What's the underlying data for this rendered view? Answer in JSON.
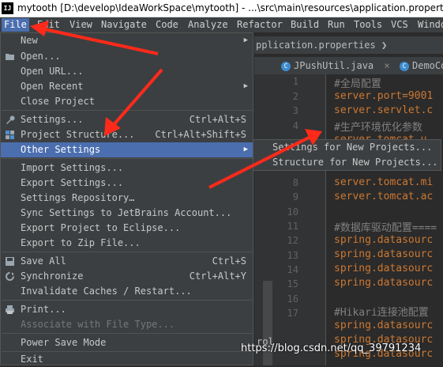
{
  "window": {
    "app_icon_text": "IJ",
    "title": "mytooth [D:\\develop\\IdeaWorkSpace\\mytooth] - ...\\src\\main\\resources\\application.propertie"
  },
  "menubar": {
    "items": [
      "File",
      "Edit",
      "View",
      "Navigate",
      "Code",
      "Analyze",
      "Refactor",
      "Build",
      "Run",
      "Tools",
      "VCS",
      "Windo"
    ]
  },
  "editor": {
    "breadcrumb": "pplication.properties",
    "tabs": [
      {
        "label": "JPushUtil.java",
        "close": "×"
      },
      {
        "label": "DemoCo"
      }
    ],
    "line_numbers": [
      "1",
      "2",
      "3",
      "4",
      "8",
      "9",
      "10",
      "11",
      "12",
      "13",
      "14",
      "15",
      "16",
      "17"
    ],
    "lines": [
      {
        "text": "#全局配置",
        "kind": "comment"
      },
      {
        "text": "server.port=9001",
        "kind": "key"
      },
      {
        "text": "server.servlet.c",
        "kind": "key"
      },
      {
        "text": "#生产环境优化参数",
        "kind": "comment"
      },
      {
        "text": "server.tomcat.u",
        "kind": "key"
      },
      {
        "text": "server.tomcat.mi",
        "kind": "key"
      },
      {
        "text": "server.tomcat.ac",
        "kind": "key"
      },
      {
        "text": "#数据库驱动配置====",
        "kind": "comment"
      },
      {
        "text": "spring.datasourc",
        "kind": "key"
      },
      {
        "text": "spring.datasourc",
        "kind": "key"
      },
      {
        "text": "spring.datasourc",
        "kind": "key"
      },
      {
        "text": "spring.datasourc",
        "kind": "key"
      },
      {
        "text": "#Hikari连接池配置",
        "kind": "comment"
      },
      {
        "text": "spring.datasourc",
        "kind": "key"
      },
      {
        "text": "spring.datasourc",
        "kind": "key"
      },
      {
        "text": "spring.datasourc",
        "kind": "key"
      }
    ],
    "fragment": "rol"
  },
  "file_menu": {
    "items": [
      {
        "label": "New",
        "shortcut": "",
        "submenu": true,
        "icon": ""
      },
      {
        "label": "Open...",
        "shortcut": "",
        "submenu": false,
        "icon": "folder-icon"
      },
      {
        "label": "Open URL...",
        "shortcut": "",
        "submenu": false,
        "icon": ""
      },
      {
        "label": "Open Recent",
        "shortcut": "",
        "submenu": true,
        "icon": ""
      },
      {
        "label": "Close Project",
        "shortcut": "",
        "submenu": false,
        "icon": ""
      },
      {
        "label": "Settings...",
        "shortcut": "Ctrl+Alt+S",
        "submenu": false,
        "icon": "wrench-icon"
      },
      {
        "label": "Project Structure...",
        "shortcut": "Ctrl+Alt+Shift+S",
        "submenu": false,
        "icon": "project-structure-icon"
      },
      {
        "label": "Other Settings",
        "shortcut": "",
        "submenu": true,
        "icon": "",
        "highlighted": true
      },
      {
        "label": "Import Settings...",
        "shortcut": "",
        "submenu": false,
        "icon": ""
      },
      {
        "label": "Export Settings...",
        "shortcut": "",
        "submenu": false,
        "icon": ""
      },
      {
        "label": "Settings Repository…",
        "shortcut": "",
        "submenu": false,
        "icon": ""
      },
      {
        "label": "Sync Settings to JetBrains Account...",
        "shortcut": "",
        "submenu": false,
        "icon": ""
      },
      {
        "label": "Export Project to Eclipse...",
        "shortcut": "",
        "submenu": false,
        "icon": ""
      },
      {
        "label": "Export to Zip File...",
        "shortcut": "",
        "submenu": false,
        "icon": ""
      },
      {
        "label": "Save All",
        "shortcut": "Ctrl+S",
        "submenu": false,
        "icon": "save-icon"
      },
      {
        "label": "Synchronize",
        "shortcut": "Ctrl+Alt+Y",
        "submenu": false,
        "icon": "sync-icon"
      },
      {
        "label": "Invalidate Caches / Restart...",
        "shortcut": "",
        "submenu": false,
        "icon": ""
      },
      {
        "label": "Print...",
        "shortcut": "",
        "submenu": false,
        "icon": "print-icon"
      },
      {
        "label": "Associate with File Type...",
        "shortcut": "",
        "submenu": false,
        "icon": "",
        "disabled": true
      },
      {
        "label": "Power Save Mode",
        "shortcut": "",
        "submenu": false,
        "icon": ""
      },
      {
        "label": "Exit",
        "shortcut": "",
        "submenu": false,
        "icon": ""
      }
    ]
  },
  "other_settings_submenu": {
    "items": [
      "Settings for New Projects...",
      "Structure for New Projects..."
    ]
  },
  "watermark": "https://blog.csdn.net/qq_39791234",
  "colors": {
    "accent": "#4b6eaf",
    "arrow": "#ff2a1a",
    "keyword": "#cc7832",
    "comment": "#808080"
  }
}
